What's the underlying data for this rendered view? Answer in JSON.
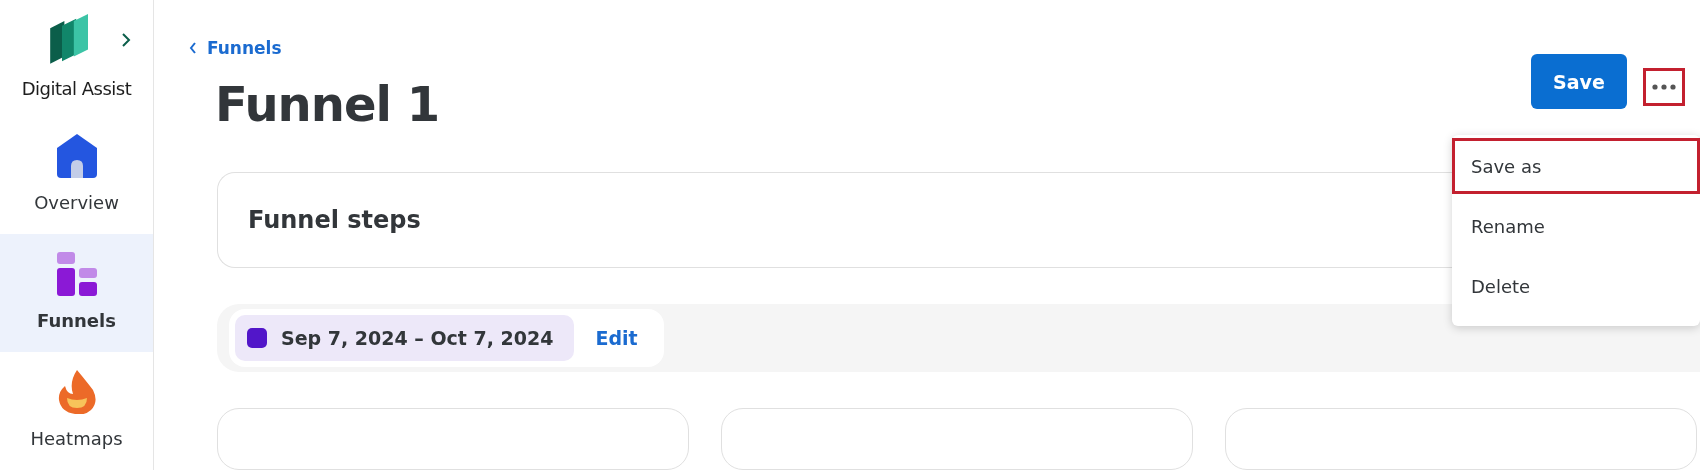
{
  "sidebar": {
    "app_name": "Digital Assist",
    "items": [
      {
        "label": "Overview",
        "kind": "home",
        "selected": false
      },
      {
        "label": "Funnels",
        "kind": "funnel",
        "selected": true
      },
      {
        "label": "Heatmaps",
        "kind": "flame",
        "selected": false
      }
    ]
  },
  "breadcrumb": "Funnels",
  "title": "Funnel 1",
  "save_button": {
    "label": "Save"
  },
  "more_button": {
    "highlighted": true
  },
  "menu": [
    {
      "label": "Save as",
      "highlighted": true
    },
    {
      "label": "Rename",
      "highlighted": false
    },
    {
      "label": "Delete",
      "highlighted": false
    }
  ],
  "steps_card": {
    "title": "Funnel steps"
  },
  "date_filter": {
    "range": "Sep 7, 2024 – Oct 7, 2024",
    "color": "#5216c9",
    "edit": "Edit"
  }
}
